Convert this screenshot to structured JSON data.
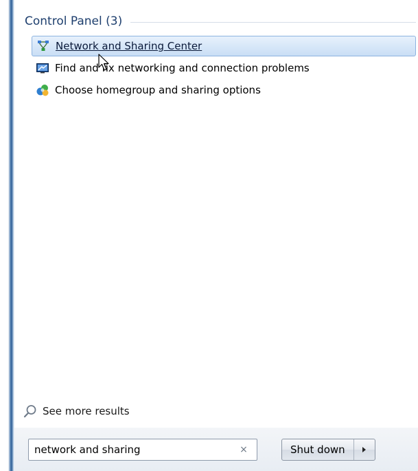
{
  "results": {
    "group_title": "Control Panel (3)",
    "items": [
      {
        "label": "Network and Sharing Center",
        "icon": "network-sharing-icon",
        "selected": true
      },
      {
        "label": "Find and fix networking and connection problems",
        "icon": "troubleshoot-icon",
        "selected": false
      },
      {
        "label": "Choose homegroup and sharing options",
        "icon": "homegroup-icon",
        "selected": false
      }
    ]
  },
  "see_more": {
    "label": "See more results",
    "icon": "search-icon"
  },
  "search": {
    "value": "network and sharing",
    "clear_glyph": "×"
  },
  "power": {
    "shutdown_label": "Shut down",
    "arrow_icon": "arrow-right-icon"
  },
  "colors": {
    "group_title": "#1e3f6e",
    "selection_border": "#8cb3e0",
    "selection_fill": "#c9def5",
    "bottom_bar": "#e8edf3"
  }
}
